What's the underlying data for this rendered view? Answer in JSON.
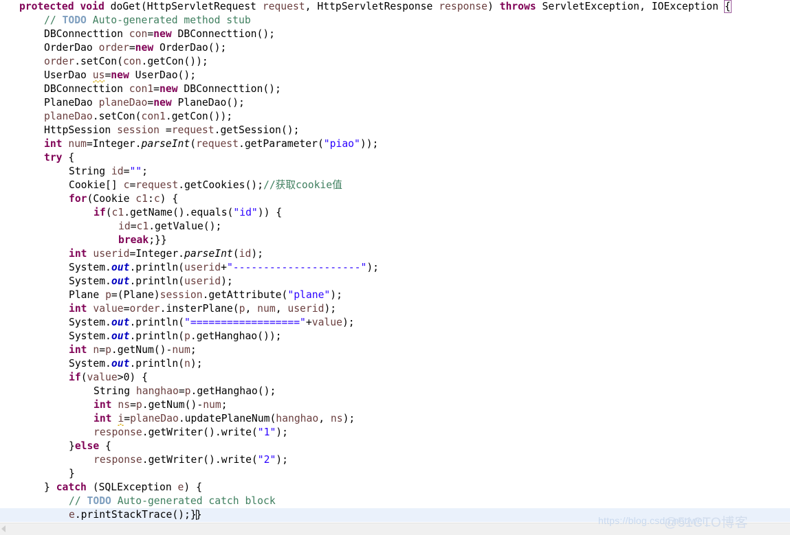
{
  "editor": {
    "language": "java",
    "colors": {
      "keyword": "#7f0055",
      "string": "#2a00ff",
      "comment": "#3f7f5f",
      "todo_tag": "#7f9fbf",
      "local_variable": "#6a3e3e",
      "static_field": "#0000c0",
      "plain_text": "#000000",
      "current_line_highlight": "#eaf1fb",
      "warning_squiggle": "#d6a800",
      "background": "#ffffff"
    }
  },
  "code": {
    "lines": [
      {
        "indent": 0,
        "current": false,
        "tokens": [
          {
            "t": "kw",
            "v": "protected"
          },
          {
            "t": "plain",
            "v": " "
          },
          {
            "t": "kw",
            "v": "void"
          },
          {
            "t": "plain",
            "v": " doGet(HttpServletRequest "
          },
          {
            "t": "lvar",
            "v": "request"
          },
          {
            "t": "plain",
            "v": ", HttpServletResponse "
          },
          {
            "t": "lvar",
            "v": "response"
          },
          {
            "t": "plain",
            "v": ") "
          },
          {
            "t": "kw",
            "v": "throws"
          },
          {
            "t": "plain",
            "v": " ServletException, IOException "
          },
          {
            "t": "brmatch",
            "v": "{"
          }
        ]
      },
      {
        "indent": 1,
        "current": false,
        "tokens": [
          {
            "t": "cmt",
            "v": "// "
          },
          {
            "t": "todo",
            "v": "TODO"
          },
          {
            "t": "cmt",
            "v": " Auto-generated method stub"
          }
        ]
      },
      {
        "indent": 1,
        "current": false,
        "tokens": [
          {
            "t": "plain",
            "v": "DBConnecttion "
          },
          {
            "t": "lvar",
            "v": "con"
          },
          {
            "t": "plain",
            "v": "="
          },
          {
            "t": "kw",
            "v": "new"
          },
          {
            "t": "plain",
            "v": " DBConnecttion();"
          }
        ]
      },
      {
        "indent": 1,
        "current": false,
        "tokens": [
          {
            "t": "plain",
            "v": "OrderDao "
          },
          {
            "t": "lvar",
            "v": "order"
          },
          {
            "t": "plain",
            "v": "="
          },
          {
            "t": "kw",
            "v": "new"
          },
          {
            "t": "plain",
            "v": " OrderDao();"
          }
        ]
      },
      {
        "indent": 1,
        "current": false,
        "tokens": [
          {
            "t": "lvar",
            "v": "order"
          },
          {
            "t": "plain",
            "v": ".setCon("
          },
          {
            "t": "lvar",
            "v": "con"
          },
          {
            "t": "plain",
            "v": ".getCon());"
          }
        ]
      },
      {
        "indent": 1,
        "current": false,
        "tokens": [
          {
            "t": "plain",
            "v": "UserDao "
          },
          {
            "t": "lvar warn",
            "v": "us"
          },
          {
            "t": "plain",
            "v": "="
          },
          {
            "t": "kw",
            "v": "new"
          },
          {
            "t": "plain",
            "v": " UserDao();"
          }
        ]
      },
      {
        "indent": 1,
        "current": false,
        "tokens": [
          {
            "t": "plain",
            "v": "DBConnecttion "
          },
          {
            "t": "lvar",
            "v": "con1"
          },
          {
            "t": "plain",
            "v": "="
          },
          {
            "t": "kw",
            "v": "new"
          },
          {
            "t": "plain",
            "v": " DBConnecttion();"
          }
        ]
      },
      {
        "indent": 1,
        "current": false,
        "tokens": [
          {
            "t": "plain",
            "v": "PlaneDao "
          },
          {
            "t": "lvar",
            "v": "planeDao"
          },
          {
            "t": "plain",
            "v": "="
          },
          {
            "t": "kw",
            "v": "new"
          },
          {
            "t": "plain",
            "v": " PlaneDao();"
          }
        ]
      },
      {
        "indent": 1,
        "current": false,
        "tokens": [
          {
            "t": "lvar",
            "v": "planeDao"
          },
          {
            "t": "plain",
            "v": ".setCon("
          },
          {
            "t": "lvar",
            "v": "con1"
          },
          {
            "t": "plain",
            "v": ".getCon());"
          }
        ]
      },
      {
        "indent": 1,
        "current": false,
        "tokens": [
          {
            "t": "plain",
            "v": "HttpSession "
          },
          {
            "t": "lvar",
            "v": "session"
          },
          {
            "t": "plain",
            "v": " ="
          },
          {
            "t": "lvar",
            "v": "request"
          },
          {
            "t": "plain",
            "v": ".getSession();"
          }
        ]
      },
      {
        "indent": 1,
        "current": false,
        "tokens": [
          {
            "t": "kw",
            "v": "int"
          },
          {
            "t": "plain",
            "v": " "
          },
          {
            "t": "lvar",
            "v": "num"
          },
          {
            "t": "plain",
            "v": "=Integer."
          },
          {
            "t": "smeth",
            "v": "parseInt"
          },
          {
            "t": "plain",
            "v": "("
          },
          {
            "t": "lvar",
            "v": "request"
          },
          {
            "t": "plain",
            "v": ".getParameter("
          },
          {
            "t": "str",
            "v": "\"piao\""
          },
          {
            "t": "plain",
            "v": "));"
          }
        ]
      },
      {
        "indent": 1,
        "current": false,
        "tokens": [
          {
            "t": "kw",
            "v": "try"
          },
          {
            "t": "plain",
            "v": " {"
          }
        ]
      },
      {
        "indent": 2,
        "current": false,
        "tokens": [
          {
            "t": "plain",
            "v": "String "
          },
          {
            "t": "lvar",
            "v": "id"
          },
          {
            "t": "plain",
            "v": "="
          },
          {
            "t": "str",
            "v": "\"\""
          },
          {
            "t": "plain",
            "v": ";"
          }
        ]
      },
      {
        "indent": 2,
        "current": false,
        "tokens": [
          {
            "t": "plain",
            "v": "Cookie[] "
          },
          {
            "t": "lvar",
            "v": "c"
          },
          {
            "t": "plain",
            "v": "="
          },
          {
            "t": "lvar",
            "v": "request"
          },
          {
            "t": "plain",
            "v": ".getCookies();"
          },
          {
            "t": "cmt",
            "v": "//获取cookie值"
          }
        ]
      },
      {
        "indent": 2,
        "current": false,
        "tokens": [
          {
            "t": "kw",
            "v": "for"
          },
          {
            "t": "plain",
            "v": "(Cookie "
          },
          {
            "t": "lvar",
            "v": "c1"
          },
          {
            "t": "plain",
            "v": ":"
          },
          {
            "t": "lvar",
            "v": "c"
          },
          {
            "t": "plain",
            "v": ") {"
          }
        ]
      },
      {
        "indent": 3,
        "current": false,
        "tokens": [
          {
            "t": "kw",
            "v": "if"
          },
          {
            "t": "plain",
            "v": "("
          },
          {
            "t": "lvar",
            "v": "c1"
          },
          {
            "t": "plain",
            "v": ".getName().equals("
          },
          {
            "t": "str",
            "v": "\"id\""
          },
          {
            "t": "plain",
            "v": ")) {"
          }
        ]
      },
      {
        "indent": 4,
        "current": false,
        "tokens": [
          {
            "t": "lvar",
            "v": "id"
          },
          {
            "t": "plain",
            "v": "="
          },
          {
            "t": "lvar",
            "v": "c1"
          },
          {
            "t": "plain",
            "v": ".getValue();"
          }
        ]
      },
      {
        "indent": 4,
        "current": false,
        "tokens": [
          {
            "t": "kw",
            "v": "break"
          },
          {
            "t": "plain",
            "v": ";}}"
          }
        ]
      },
      {
        "indent": 2,
        "current": false,
        "tokens": [
          {
            "t": "kw",
            "v": "int"
          },
          {
            "t": "plain",
            "v": " "
          },
          {
            "t": "lvar",
            "v": "userid"
          },
          {
            "t": "plain",
            "v": "=Integer."
          },
          {
            "t": "smeth",
            "v": "parseInt"
          },
          {
            "t": "plain",
            "v": "("
          },
          {
            "t": "lvar",
            "v": "id"
          },
          {
            "t": "plain",
            "v": ");"
          }
        ]
      },
      {
        "indent": 2,
        "current": false,
        "tokens": [
          {
            "t": "plain",
            "v": "System."
          },
          {
            "t": "field",
            "v": "out"
          },
          {
            "t": "plain",
            "v": ".println("
          },
          {
            "t": "lvar",
            "v": "userid"
          },
          {
            "t": "plain",
            "v": "+"
          },
          {
            "t": "str",
            "v": "\"---------------------\""
          },
          {
            "t": "plain",
            "v": ");"
          }
        ]
      },
      {
        "indent": 2,
        "current": false,
        "tokens": [
          {
            "t": "plain",
            "v": "System."
          },
          {
            "t": "field",
            "v": "out"
          },
          {
            "t": "plain",
            "v": ".println("
          },
          {
            "t": "lvar",
            "v": "userid"
          },
          {
            "t": "plain",
            "v": ");"
          }
        ]
      },
      {
        "indent": 2,
        "current": false,
        "tokens": [
          {
            "t": "plain",
            "v": "Plane "
          },
          {
            "t": "lvar",
            "v": "p"
          },
          {
            "t": "plain",
            "v": "=(Plane)"
          },
          {
            "t": "lvar",
            "v": "session"
          },
          {
            "t": "plain",
            "v": ".getAttribute("
          },
          {
            "t": "str",
            "v": "\"plane\""
          },
          {
            "t": "plain",
            "v": ");"
          }
        ]
      },
      {
        "indent": 2,
        "current": false,
        "tokens": [
          {
            "t": "kw",
            "v": "int"
          },
          {
            "t": "plain",
            "v": " "
          },
          {
            "t": "lvar",
            "v": "value"
          },
          {
            "t": "plain",
            "v": "="
          },
          {
            "t": "lvar",
            "v": "order"
          },
          {
            "t": "plain",
            "v": ".insterPlane("
          },
          {
            "t": "lvar",
            "v": "p"
          },
          {
            "t": "plain",
            "v": ", "
          },
          {
            "t": "lvar",
            "v": "num"
          },
          {
            "t": "plain",
            "v": ", "
          },
          {
            "t": "lvar",
            "v": "userid"
          },
          {
            "t": "plain",
            "v": ");"
          }
        ]
      },
      {
        "indent": 2,
        "current": false,
        "tokens": [
          {
            "t": "plain",
            "v": "System."
          },
          {
            "t": "field",
            "v": "out"
          },
          {
            "t": "plain",
            "v": ".println("
          },
          {
            "t": "str",
            "v": "\"==================\""
          },
          {
            "t": "plain",
            "v": "+"
          },
          {
            "t": "lvar",
            "v": "value"
          },
          {
            "t": "plain",
            "v": ");"
          }
        ]
      },
      {
        "indent": 2,
        "current": false,
        "tokens": [
          {
            "t": "plain",
            "v": "System."
          },
          {
            "t": "field",
            "v": "out"
          },
          {
            "t": "plain",
            "v": ".println("
          },
          {
            "t": "lvar",
            "v": "p"
          },
          {
            "t": "plain",
            "v": ".getHanghao());"
          }
        ]
      },
      {
        "indent": 2,
        "current": false,
        "tokens": [
          {
            "t": "kw",
            "v": "int"
          },
          {
            "t": "plain",
            "v": " "
          },
          {
            "t": "lvar",
            "v": "n"
          },
          {
            "t": "plain",
            "v": "="
          },
          {
            "t": "lvar",
            "v": "p"
          },
          {
            "t": "plain",
            "v": ".getNum()-"
          },
          {
            "t": "lvar",
            "v": "num"
          },
          {
            "t": "plain",
            "v": ";"
          }
        ]
      },
      {
        "indent": 2,
        "current": false,
        "tokens": [
          {
            "t": "plain",
            "v": "System."
          },
          {
            "t": "field",
            "v": "out"
          },
          {
            "t": "plain",
            "v": ".println("
          },
          {
            "t": "lvar",
            "v": "n"
          },
          {
            "t": "plain",
            "v": ");"
          }
        ]
      },
      {
        "indent": 2,
        "current": false,
        "tokens": [
          {
            "t": "kw",
            "v": "if"
          },
          {
            "t": "plain",
            "v": "("
          },
          {
            "t": "lvar",
            "v": "value"
          },
          {
            "t": "plain",
            "v": ">0) {"
          }
        ]
      },
      {
        "indent": 3,
        "current": false,
        "tokens": [
          {
            "t": "plain",
            "v": "String "
          },
          {
            "t": "lvar",
            "v": "hanghao"
          },
          {
            "t": "plain",
            "v": "="
          },
          {
            "t": "lvar",
            "v": "p"
          },
          {
            "t": "plain",
            "v": ".getHanghao();"
          }
        ]
      },
      {
        "indent": 3,
        "current": false,
        "tokens": [
          {
            "t": "kw",
            "v": "int"
          },
          {
            "t": "plain",
            "v": " "
          },
          {
            "t": "lvar",
            "v": "ns"
          },
          {
            "t": "plain",
            "v": "="
          },
          {
            "t": "lvar",
            "v": "p"
          },
          {
            "t": "plain",
            "v": ".getNum()-"
          },
          {
            "t": "lvar",
            "v": "num"
          },
          {
            "t": "plain",
            "v": ";"
          }
        ]
      },
      {
        "indent": 3,
        "current": false,
        "tokens": [
          {
            "t": "kw",
            "v": "int"
          },
          {
            "t": "plain",
            "v": " "
          },
          {
            "t": "lvar warn",
            "v": "i"
          },
          {
            "t": "plain",
            "v": "="
          },
          {
            "t": "lvar",
            "v": "planeDao"
          },
          {
            "t": "plain",
            "v": ".updatePlaneNum("
          },
          {
            "t": "lvar",
            "v": "hanghao"
          },
          {
            "t": "plain",
            "v": ", "
          },
          {
            "t": "lvar",
            "v": "ns"
          },
          {
            "t": "plain",
            "v": ");"
          }
        ]
      },
      {
        "indent": 3,
        "current": false,
        "tokens": [
          {
            "t": "lvar",
            "v": "response"
          },
          {
            "t": "plain",
            "v": ".getWriter().write("
          },
          {
            "t": "str",
            "v": "\"1\""
          },
          {
            "t": "plain",
            "v": ");"
          }
        ]
      },
      {
        "indent": 2,
        "current": false,
        "tokens": [
          {
            "t": "plain",
            "v": "}"
          },
          {
            "t": "kw",
            "v": "else"
          },
          {
            "t": "plain",
            "v": " {"
          }
        ]
      },
      {
        "indent": 3,
        "current": false,
        "tokens": [
          {
            "t": "lvar",
            "v": "response"
          },
          {
            "t": "plain",
            "v": ".getWriter().write("
          },
          {
            "t": "str",
            "v": "\"2\""
          },
          {
            "t": "plain",
            "v": ");"
          }
        ]
      },
      {
        "indent": 2,
        "current": false,
        "tokens": [
          {
            "t": "plain",
            "v": "}"
          }
        ]
      },
      {
        "indent": 1,
        "current": false,
        "tokens": [
          {
            "t": "plain",
            "v": "} "
          },
          {
            "t": "kw",
            "v": "catch"
          },
          {
            "t": "plain",
            "v": " (SQLException "
          },
          {
            "t": "lvar",
            "v": "e"
          },
          {
            "t": "plain",
            "v": ") {"
          }
        ]
      },
      {
        "indent": 2,
        "current": false,
        "tokens": [
          {
            "t": "cmt",
            "v": "// "
          },
          {
            "t": "todo",
            "v": "TODO"
          },
          {
            "t": "cmt",
            "v": " Auto-generated catch block"
          }
        ]
      },
      {
        "indent": 2,
        "current": true,
        "tokens": [
          {
            "t": "lvar",
            "v": "e"
          },
          {
            "t": "plain",
            "v": ".printStackTrace();}"
          },
          {
            "t": "caret",
            "v": ""
          },
          {
            "t": "plain",
            "v": "}"
          }
        ]
      }
    ]
  },
  "watermarks": {
    "csdn": "https://blog.csdn.net/wei_",
    "cto": "@51CTO博客"
  }
}
